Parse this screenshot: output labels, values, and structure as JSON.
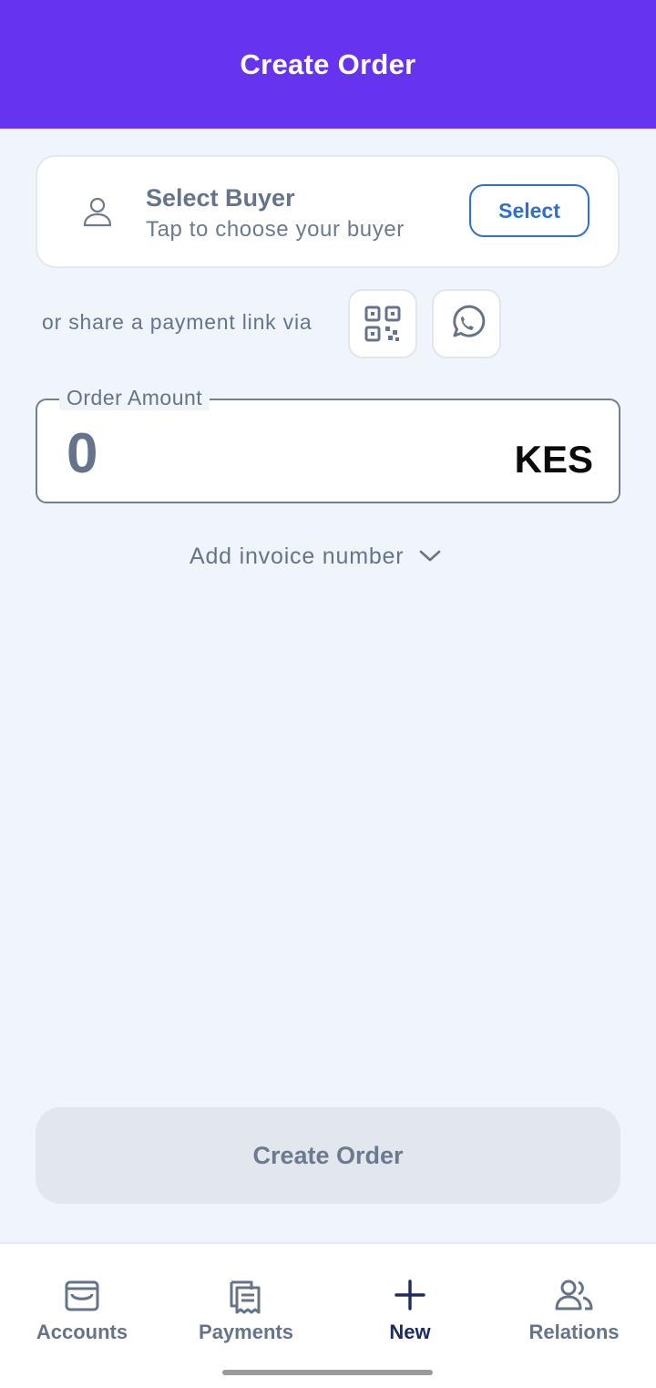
{
  "header": {
    "title": "Create Order"
  },
  "buyer": {
    "title": "Select Buyer",
    "subtitle": "Tap to choose your buyer",
    "select_label": "Select",
    "icon": "user-icon"
  },
  "share": {
    "text": "or share a payment link via",
    "qr_icon": "qr-code-icon",
    "whatsapp_icon": "whatsapp-icon"
  },
  "amount": {
    "label": "Order Amount",
    "value": "0",
    "currency": "KES"
  },
  "invoice": {
    "label": "Add invoice number",
    "icon": "chevron-down-icon"
  },
  "create_button": {
    "label": "Create Order"
  },
  "nav": {
    "items": [
      {
        "label": "Accounts",
        "icon": "wallet-icon"
      },
      {
        "label": "Payments",
        "icon": "receipt-icon"
      },
      {
        "label": "New",
        "icon": "plus-icon",
        "active": true
      },
      {
        "label": "Relations",
        "icon": "users-icon"
      }
    ]
  },
  "colors": {
    "header_bg": "#6634EF",
    "page_bg": "#F0F4FB",
    "accent_blue": "#2F6FD2",
    "muted_text": "#65748B",
    "active_nav": "#1C2B63"
  }
}
